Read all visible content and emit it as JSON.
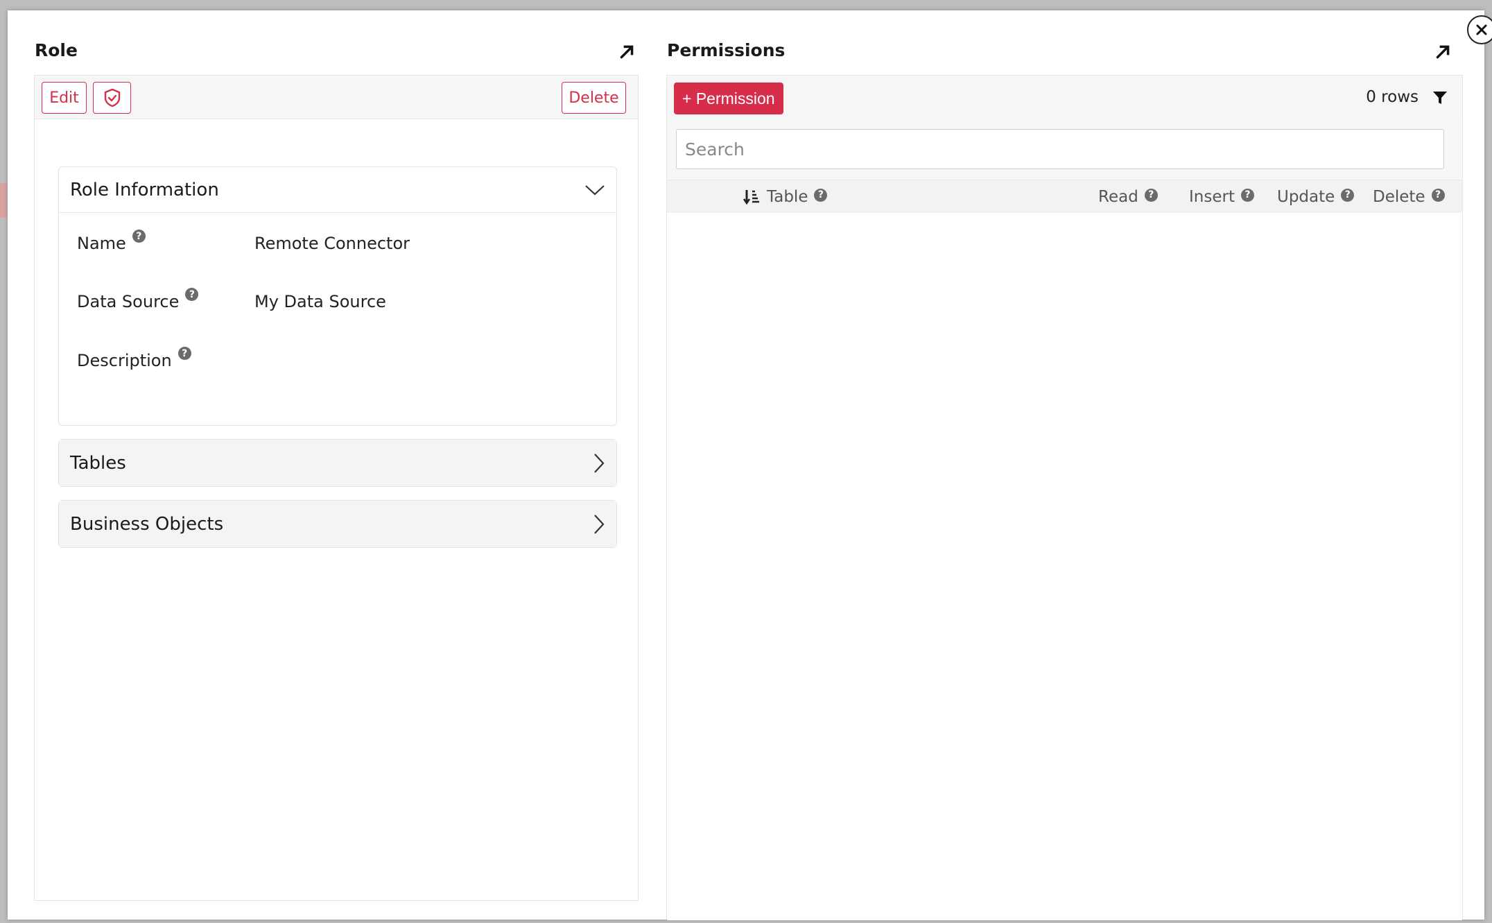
{
  "role_panel": {
    "title": "Role",
    "toolbar": {
      "edit_label": "Edit",
      "delete_label": "Delete"
    },
    "role_information": {
      "header": "Role Information",
      "fields": [
        {
          "label": "Name",
          "value": "Remote Connector"
        },
        {
          "label": "Data Source",
          "value": "My Data Source"
        },
        {
          "label": "Description",
          "value": ""
        }
      ]
    },
    "sections": [
      {
        "label": "Tables"
      },
      {
        "label": "Business Objects"
      }
    ]
  },
  "permissions_panel": {
    "title": "Permissions",
    "add_button_label": "+ Permission",
    "rows_count": "0 rows",
    "search": {
      "placeholder": "Search",
      "value": ""
    },
    "columns": [
      "Table",
      "Read",
      "Insert",
      "Update",
      "Delete"
    ]
  },
  "icons": {
    "close": "close-icon",
    "expand": "arrow-up-right-icon",
    "shield": "shield-check-icon",
    "filter": "filter-icon",
    "sort": "sort-descending-icon",
    "help": "question-circle-icon",
    "chevron_down": "chevron-down-icon",
    "chevron_right": "chevron-right-icon"
  },
  "colors": {
    "accent": "#d62d4b",
    "panel_bg": "#f6f6f6"
  }
}
